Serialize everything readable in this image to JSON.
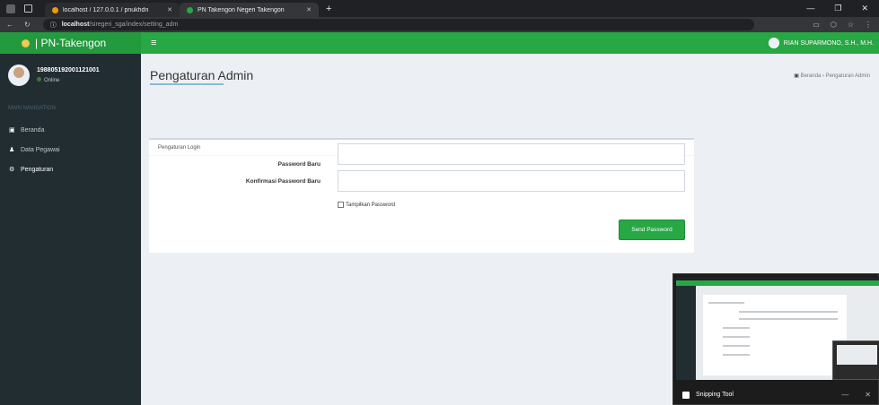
{
  "browser": {
    "tabs": [
      {
        "label": "localhost / 127.0.0.1 / pnukhdn",
        "favicon_color": "#f29900"
      },
      {
        "label": "PN Takengon Negeri Takengon",
        "favicon_color": "#28a745"
      }
    ],
    "address": {
      "host": "localhost",
      "path": "/siregeri_sga/index/setting_adm"
    }
  },
  "navbar": {
    "brand": "| PN-Takengon",
    "user_name": "RIAN SUPARMONO, S.H., M.H."
  },
  "sidebar": {
    "user_id": "198805192001121001",
    "status": "Online",
    "header": "MAIN NAVIGATION",
    "items": [
      {
        "label": "Beranda",
        "icon": "dashboard-icon"
      },
      {
        "label": "Data Pegawai",
        "icon": "user-icon"
      },
      {
        "label": "Pengaturan",
        "icon": "settings-icon"
      }
    ]
  },
  "content": {
    "title": "Pengaturan Admin",
    "breadcrumb": {
      "home": "Beranda",
      "current": "Pengaturan Admin"
    },
    "card_title": "Pengaturan Login",
    "new_password_label": "Password Baru",
    "confirm_password_label": "Konfirmasi Password Baru",
    "show_password_label": "Tampilkan Password",
    "submit_label": "Send Password"
  },
  "snipping_tool": {
    "title": "Snipping Tool"
  },
  "colors": {
    "primary": "#28a745",
    "sidebar": "#222d32",
    "content_bg": "#ecf0f5"
  }
}
